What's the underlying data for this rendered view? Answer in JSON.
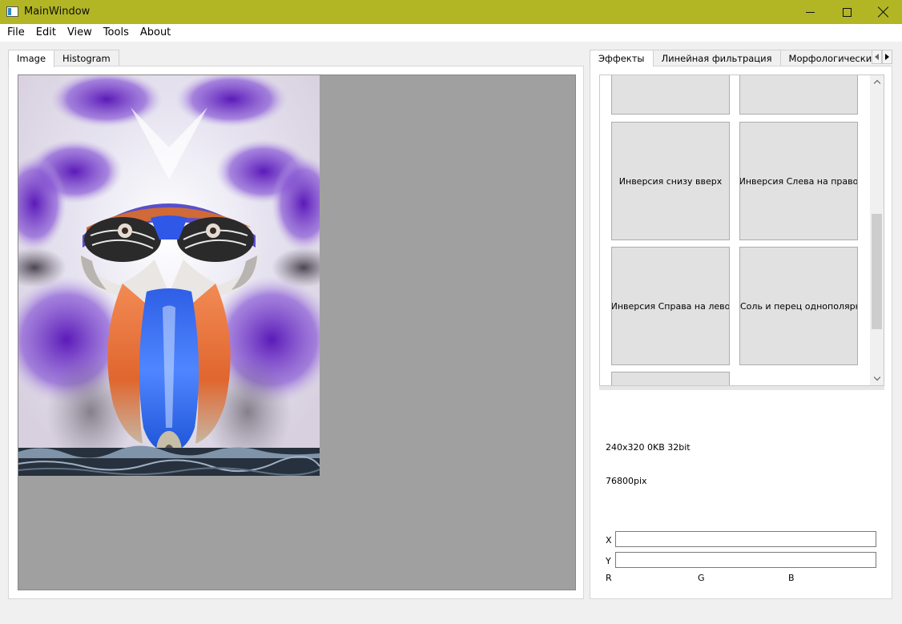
{
  "window": {
    "title": "MainWindow"
  },
  "menu": [
    "File",
    "Edit",
    "View",
    "Tools",
    "About"
  ],
  "left_tabs": [
    "Image",
    "Histogram"
  ],
  "right_tabs": [
    "Эффекты",
    "Линейная фильтрация",
    "Морфологические преобр"
  ],
  "effects": {
    "buttons": [
      "Инверсия снизу вверх",
      "Инверсия Слева на право",
      "Инверсия Справа на лево",
      "Соль и перец однополярный"
    ]
  },
  "image_info": {
    "summary": "240x320 0KB 32bit",
    "pixels": "76800pix"
  },
  "coords": {
    "x_label": "X",
    "y_label": "Y",
    "x_value": "",
    "y_value": ""
  },
  "rgb": {
    "r_label": "R",
    "g_label": "G",
    "b_label": "B"
  },
  "colors": {
    "title_bar": "#b2b624",
    "image_bg": "#a0a0a0"
  }
}
